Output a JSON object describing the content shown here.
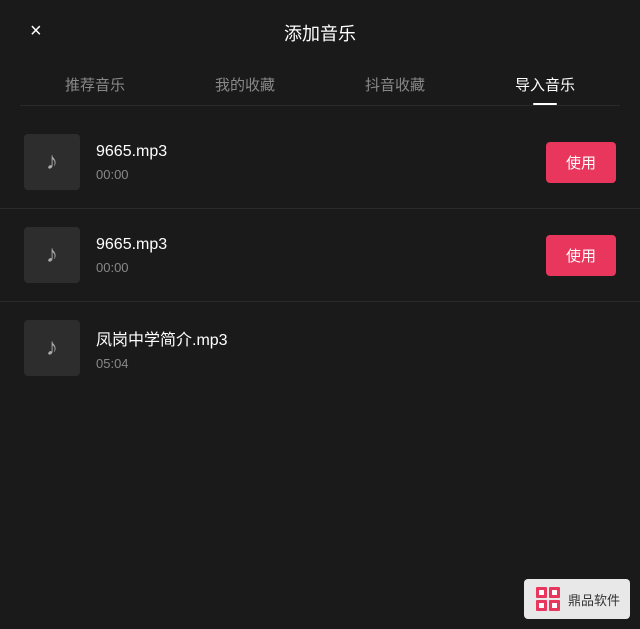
{
  "header": {
    "title": "添加音乐",
    "close_label": "×"
  },
  "tabs": [
    {
      "id": "recommend",
      "label": "推荐音乐",
      "active": false
    },
    {
      "id": "favorites",
      "label": "我的收藏",
      "active": false
    },
    {
      "id": "douyin",
      "label": "抖音收藏",
      "active": false
    },
    {
      "id": "import",
      "label": "导入音乐",
      "active": true
    }
  ],
  "music_list": [
    {
      "id": 1,
      "name": "9665.mp3",
      "duration": "00:00",
      "show_use": true
    },
    {
      "id": 2,
      "name": "9665.mp3",
      "duration": "00:00",
      "show_use": true
    },
    {
      "id": 3,
      "name": "凤岗中学简介.mp3",
      "duration": "05:04",
      "show_use": false
    }
  ],
  "use_button_label": "使用",
  "music_note_char": "♪",
  "watermark": {
    "brand": "鼎品软件"
  }
}
